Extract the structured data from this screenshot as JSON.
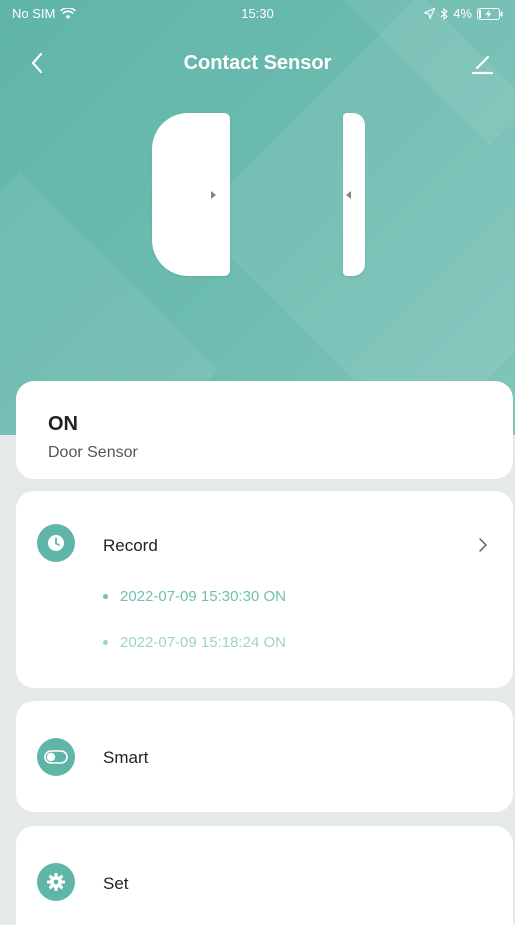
{
  "status_bar": {
    "carrier": "No SIM",
    "time": "15:30",
    "battery": "4%"
  },
  "nav": {
    "title": "Contact Sensor"
  },
  "status": {
    "state": "ON",
    "device_type": "Door Sensor"
  },
  "record": {
    "label": "Record",
    "entries": [
      "2022-07-09 15:30:30 ON",
      "2022-07-09 15:18:24 ON"
    ]
  },
  "smart": {
    "label": "Smart"
  },
  "set": {
    "label": "Set"
  },
  "colors": {
    "accent": "#5fb5a8",
    "record_text": "#6fbfb2",
    "background": "#e6e9e9"
  }
}
